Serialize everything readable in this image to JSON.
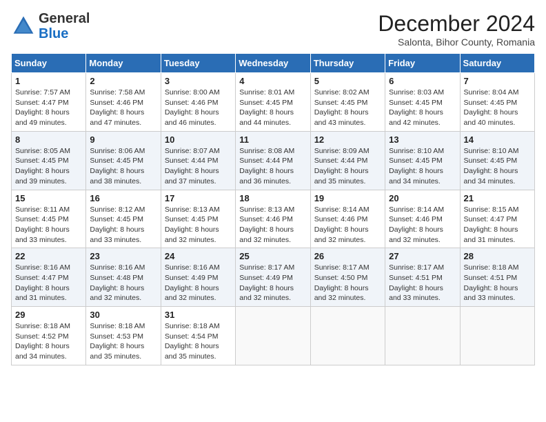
{
  "header": {
    "logo": {
      "general": "General",
      "blue": "Blue"
    },
    "title": "December 2024",
    "subtitle": "Salonta, Bihor County, Romania"
  },
  "weekdays": [
    "Sunday",
    "Monday",
    "Tuesday",
    "Wednesday",
    "Thursday",
    "Friday",
    "Saturday"
  ],
  "weeks": [
    [
      {
        "day": "1",
        "sunrise": "7:57 AM",
        "sunset": "4:47 PM",
        "daylight": "8 hours and 49 minutes."
      },
      {
        "day": "2",
        "sunrise": "7:58 AM",
        "sunset": "4:46 PM",
        "daylight": "8 hours and 47 minutes."
      },
      {
        "day": "3",
        "sunrise": "8:00 AM",
        "sunset": "4:46 PM",
        "daylight": "8 hours and 46 minutes."
      },
      {
        "day": "4",
        "sunrise": "8:01 AM",
        "sunset": "4:45 PM",
        "daylight": "8 hours and 44 minutes."
      },
      {
        "day": "5",
        "sunrise": "8:02 AM",
        "sunset": "4:45 PM",
        "daylight": "8 hours and 43 minutes."
      },
      {
        "day": "6",
        "sunrise": "8:03 AM",
        "sunset": "4:45 PM",
        "daylight": "8 hours and 42 minutes."
      },
      {
        "day": "7",
        "sunrise": "8:04 AM",
        "sunset": "4:45 PM",
        "daylight": "8 hours and 40 minutes."
      }
    ],
    [
      {
        "day": "8",
        "sunrise": "8:05 AM",
        "sunset": "4:45 PM",
        "daylight": "8 hours and 39 minutes."
      },
      {
        "day": "9",
        "sunrise": "8:06 AM",
        "sunset": "4:45 PM",
        "daylight": "8 hours and 38 minutes."
      },
      {
        "day": "10",
        "sunrise": "8:07 AM",
        "sunset": "4:44 PM",
        "daylight": "8 hours and 37 minutes."
      },
      {
        "day": "11",
        "sunrise": "8:08 AM",
        "sunset": "4:44 PM",
        "daylight": "8 hours and 36 minutes."
      },
      {
        "day": "12",
        "sunrise": "8:09 AM",
        "sunset": "4:44 PM",
        "daylight": "8 hours and 35 minutes."
      },
      {
        "day": "13",
        "sunrise": "8:10 AM",
        "sunset": "4:45 PM",
        "daylight": "8 hours and 34 minutes."
      },
      {
        "day": "14",
        "sunrise": "8:10 AM",
        "sunset": "4:45 PM",
        "daylight": "8 hours and 34 minutes."
      }
    ],
    [
      {
        "day": "15",
        "sunrise": "8:11 AM",
        "sunset": "4:45 PM",
        "daylight": "8 hours and 33 minutes."
      },
      {
        "day": "16",
        "sunrise": "8:12 AM",
        "sunset": "4:45 PM",
        "daylight": "8 hours and 33 minutes."
      },
      {
        "day": "17",
        "sunrise": "8:13 AM",
        "sunset": "4:45 PM",
        "daylight": "8 hours and 32 minutes."
      },
      {
        "day": "18",
        "sunrise": "8:13 AM",
        "sunset": "4:46 PM",
        "daylight": "8 hours and 32 minutes."
      },
      {
        "day": "19",
        "sunrise": "8:14 AM",
        "sunset": "4:46 PM",
        "daylight": "8 hours and 32 minutes."
      },
      {
        "day": "20",
        "sunrise": "8:14 AM",
        "sunset": "4:46 PM",
        "daylight": "8 hours and 32 minutes."
      },
      {
        "day": "21",
        "sunrise": "8:15 AM",
        "sunset": "4:47 PM",
        "daylight": "8 hours and 31 minutes."
      }
    ],
    [
      {
        "day": "22",
        "sunrise": "8:16 AM",
        "sunset": "4:47 PM",
        "daylight": "8 hours and 31 minutes."
      },
      {
        "day": "23",
        "sunrise": "8:16 AM",
        "sunset": "4:48 PM",
        "daylight": "8 hours and 32 minutes."
      },
      {
        "day": "24",
        "sunrise": "8:16 AM",
        "sunset": "4:49 PM",
        "daylight": "8 hours and 32 minutes."
      },
      {
        "day": "25",
        "sunrise": "8:17 AM",
        "sunset": "4:49 PM",
        "daylight": "8 hours and 32 minutes."
      },
      {
        "day": "26",
        "sunrise": "8:17 AM",
        "sunset": "4:50 PM",
        "daylight": "8 hours and 32 minutes."
      },
      {
        "day": "27",
        "sunrise": "8:17 AM",
        "sunset": "4:51 PM",
        "daylight": "8 hours and 33 minutes."
      },
      {
        "day": "28",
        "sunrise": "8:18 AM",
        "sunset": "4:51 PM",
        "daylight": "8 hours and 33 minutes."
      }
    ],
    [
      {
        "day": "29",
        "sunrise": "8:18 AM",
        "sunset": "4:52 PM",
        "daylight": "8 hours and 34 minutes."
      },
      {
        "day": "30",
        "sunrise": "8:18 AM",
        "sunset": "4:53 PM",
        "daylight": "8 hours and 35 minutes."
      },
      {
        "day": "31",
        "sunrise": "8:18 AM",
        "sunset": "4:54 PM",
        "daylight": "8 hours and 35 minutes."
      },
      null,
      null,
      null,
      null
    ]
  ]
}
